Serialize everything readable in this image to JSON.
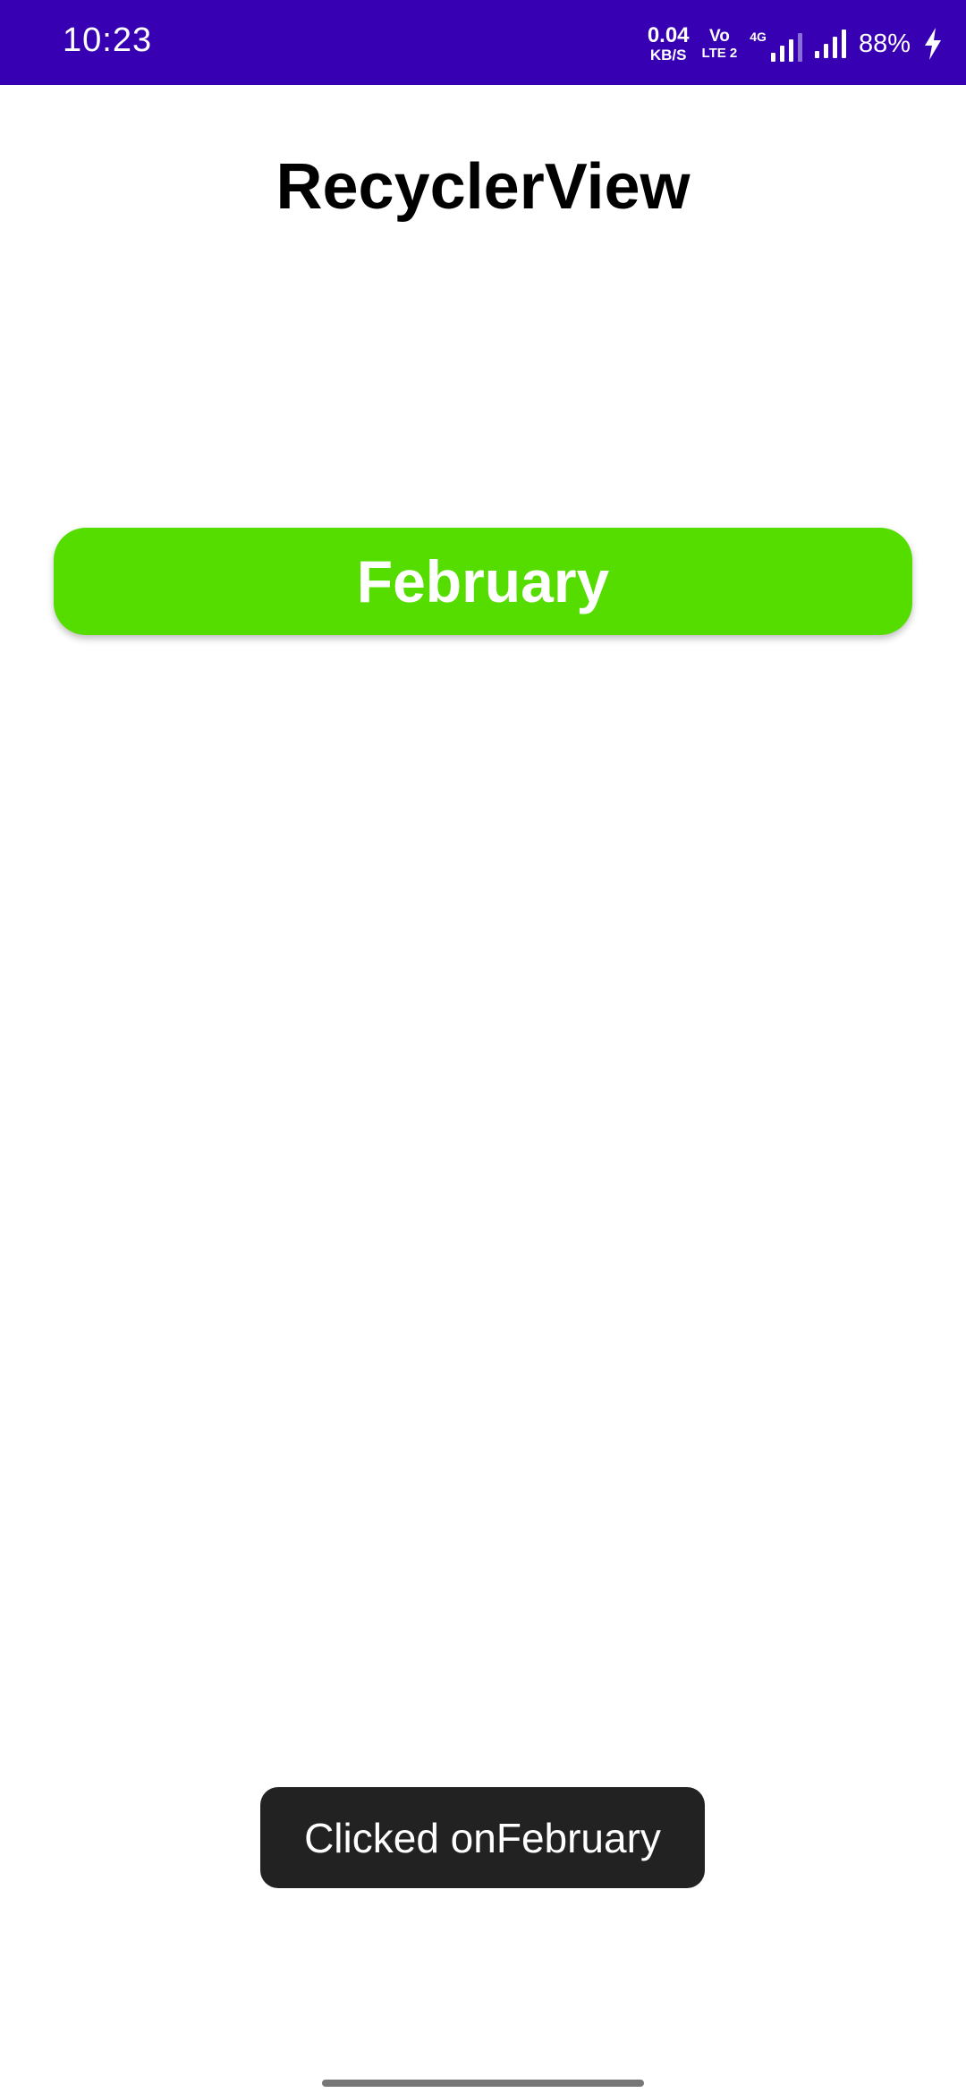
{
  "status_bar": {
    "time": "10:23",
    "net_speed_value": "0.04",
    "net_speed_unit": "KB/S",
    "volte_top": "Vo",
    "volte_bottom": "LTE 2",
    "network_type": "4G",
    "battery_percent": "88%",
    "background_color": "#3700b3"
  },
  "app": {
    "title": "RecyclerView"
  },
  "list": {
    "items": [
      {
        "label": "February",
        "color": "#55dd00"
      }
    ]
  },
  "toast": {
    "message": "Clicked onFebruary"
  },
  "icons": {
    "signal": "cell-signal-icon",
    "battery_charging": "charging-bolt-icon"
  }
}
